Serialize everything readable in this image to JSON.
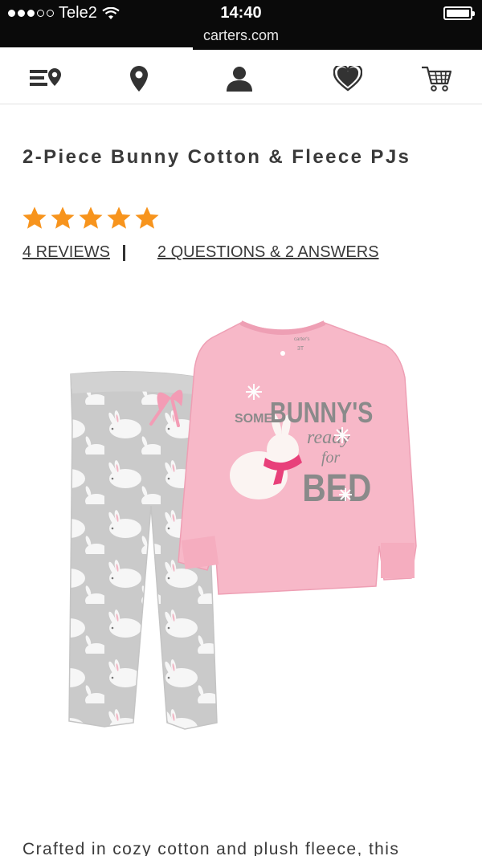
{
  "status_bar": {
    "carrier": "Tele2",
    "time": "14:40",
    "url": "carters.com",
    "load_progress": 0.4
  },
  "nav": {
    "items": [
      {
        "name": "store-locator-list",
        "icon": "list-pin-icon"
      },
      {
        "name": "location",
        "icon": "location-pin-icon"
      },
      {
        "name": "account",
        "icon": "user-icon"
      },
      {
        "name": "wishlist",
        "icon": "heart-icon"
      },
      {
        "name": "cart",
        "icon": "cart-icon"
      }
    ]
  },
  "product": {
    "title": "2-Piece Bunny Cotton & Fleece PJs",
    "rating": 5,
    "rating_max": 5,
    "reviews_link": "4 REVIEWS",
    "qa_link": "2 QUESTIONS & 2 ANSWERS",
    "image": {
      "shirt_text_1": "SOME",
      "shirt_text_2": "BUNNY'S",
      "shirt_text_3": "ready",
      "shirt_text_4": "for",
      "shirt_text_5": "BED",
      "label_text": "carter's",
      "size_text": "3T"
    },
    "description_start": "Crafted in cozy cotton and plush fleece, this"
  },
  "colors": {
    "star": "#f7941d",
    "shirt": "#f7b8c8",
    "pants": "#c9c9c9",
    "scarf": "#e8407a"
  }
}
